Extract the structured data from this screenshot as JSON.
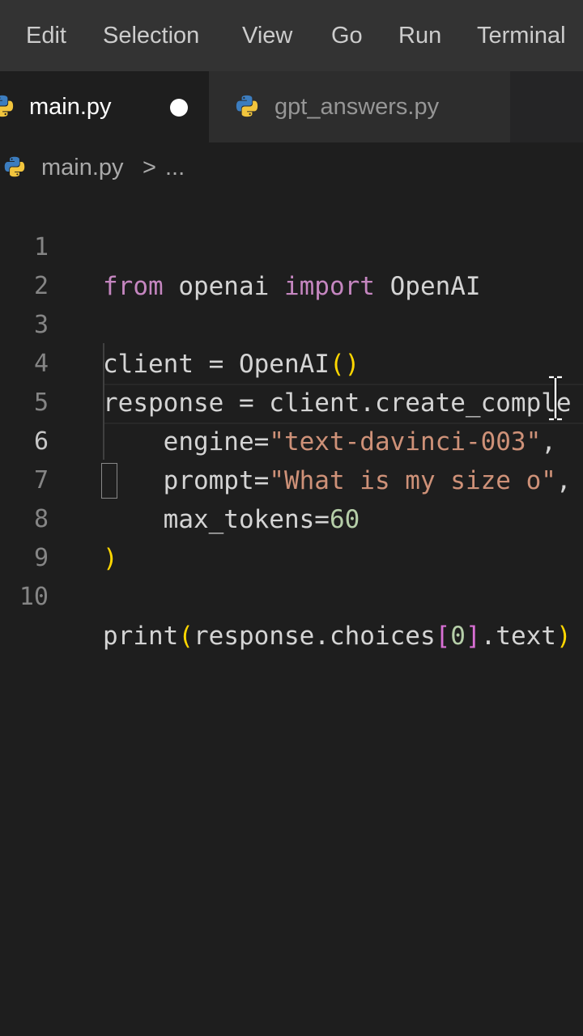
{
  "menu": {
    "items": [
      "Edit",
      "Selection",
      "View",
      "Go",
      "Run",
      "Terminal"
    ]
  },
  "tabs": [
    {
      "label": "main.py",
      "active": true,
      "dirty": true
    },
    {
      "label": "gpt_answers.py",
      "active": false,
      "dirty": false
    }
  ],
  "breadcrumb": {
    "file": "main.py",
    "separator": ">",
    "more": "..."
  },
  "editor": {
    "current_line": 6,
    "line_numbers": [
      "1",
      "2",
      "3",
      "4",
      "5",
      "6",
      "7",
      "8",
      "9",
      "10"
    ],
    "lines": [
      "from openai import OpenAI",
      "",
      "client = OpenAI()",
      "response = client.create_comple",
      "    engine=\"text-davinci-003\",",
      "    prompt=\"What is my size o\",",
      "    max_tokens=60",
      ")",
      "",
      "print(response.choices[0].text)"
    ]
  },
  "colors": {
    "keyword": "#569cd6",
    "import_keyword": "#c586c0",
    "string": "#ce9178",
    "number": "#b5cea8",
    "bracket": "#ffd700",
    "bracket_nested": "#da70d6",
    "text": "#d4d4d4",
    "background": "#1e1e1e"
  },
  "icons": {
    "file_icon": "python-icon",
    "cursor": "text-cursor-icon"
  }
}
